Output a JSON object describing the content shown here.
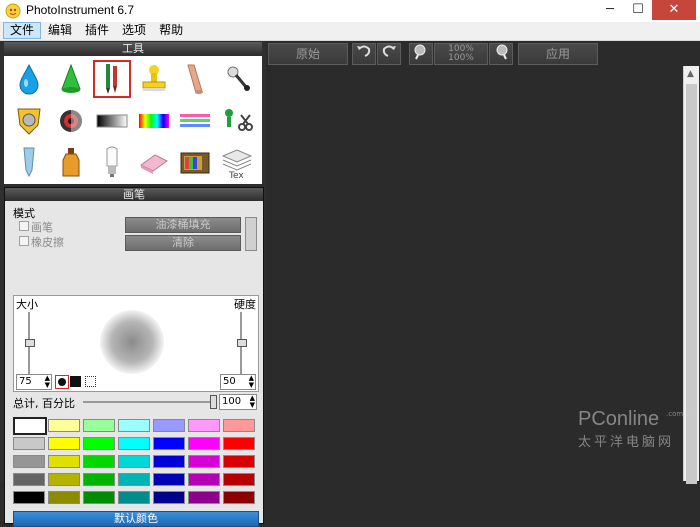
{
  "window": {
    "title": "PhotoInstrument 6.7",
    "minimize": "─",
    "maximize": "☐",
    "close": "✕"
  },
  "menu": [
    {
      "label": "文件",
      "active": true
    },
    {
      "label": "编辑"
    },
    {
      "label": "插件"
    },
    {
      "label": "选项"
    },
    {
      "label": "帮助"
    }
  ],
  "tools_panel": {
    "title": "工具",
    "tools": [
      {
        "icon": "water-drop-icon",
        "selected": false
      },
      {
        "icon": "green-cone-icon",
        "selected": false
      },
      {
        "icon": "brush-pencil-icon",
        "selected": true
      },
      {
        "icon": "stamp-icon",
        "selected": false
      },
      {
        "icon": "smudge-finger-icon",
        "selected": false
      },
      {
        "icon": "pin-icon",
        "selected": false
      },
      {
        "icon": "shield-icon",
        "selected": false
      },
      {
        "icon": "red-eye-icon",
        "selected": false
      },
      {
        "icon": "gradient-bar-icon",
        "selected": false
      },
      {
        "icon": "rainbow-bar-icon",
        "selected": false
      },
      {
        "icon": "color-lines-icon",
        "selected": false
      },
      {
        "icon": "scissors-icon",
        "selected": false
      },
      {
        "icon": "tube-icon",
        "selected": false
      },
      {
        "icon": "bottle-icon",
        "selected": false
      },
      {
        "icon": "bulb-icon",
        "selected": false
      },
      {
        "icon": "eraser-icon",
        "selected": false
      },
      {
        "icon": "tv-icon",
        "selected": false
      },
      {
        "icon": "text-layers-icon",
        "selected": false
      }
    ]
  },
  "brush_panel": {
    "title": "画笔",
    "mode_label": "模式",
    "mode_options": [
      {
        "label": "画笔",
        "checked": false
      },
      {
        "label": "橡皮擦",
        "checked": false
      }
    ],
    "fill_button": "油漆桶填充",
    "clear_button": "清除",
    "size_label": "大小",
    "hardness_label": "硬度",
    "size_value": "75",
    "hardness_value": "50",
    "total_label": "总计, 百分比",
    "total_value": "100",
    "default_colors_button": "默认颜色",
    "swatches": [
      [
        "#ffffff",
        "#ffff99",
        "#99ff99",
        "#99ffff",
        "#9999ff",
        "#ff99ff",
        "#ff9999"
      ],
      [
        "#c8c8c8",
        "#ffff00",
        "#00ff00",
        "#00ffff",
        "#0000ff",
        "#ff00ff",
        "#ff0000"
      ],
      [
        "#969696",
        "#e0e000",
        "#00d800",
        "#00d8d8",
        "#0000d8",
        "#d800d8",
        "#d80000"
      ],
      [
        "#646464",
        "#b4b400",
        "#00b400",
        "#00b4b4",
        "#0000b4",
        "#b400b4",
        "#b40000"
      ],
      [
        "#000000",
        "#8c8c00",
        "#008c00",
        "#008c8c",
        "#00008c",
        "#8c008c",
        "#8c0000"
      ]
    ]
  },
  "toolbar": {
    "original_label": "原始",
    "zoom_top": "100%",
    "zoom_bottom": "100%",
    "apply_label": "应用"
  },
  "watermark": {
    "brand": "PConline",
    "domain": ".com.cn",
    "cn": "太平洋电脑网"
  }
}
